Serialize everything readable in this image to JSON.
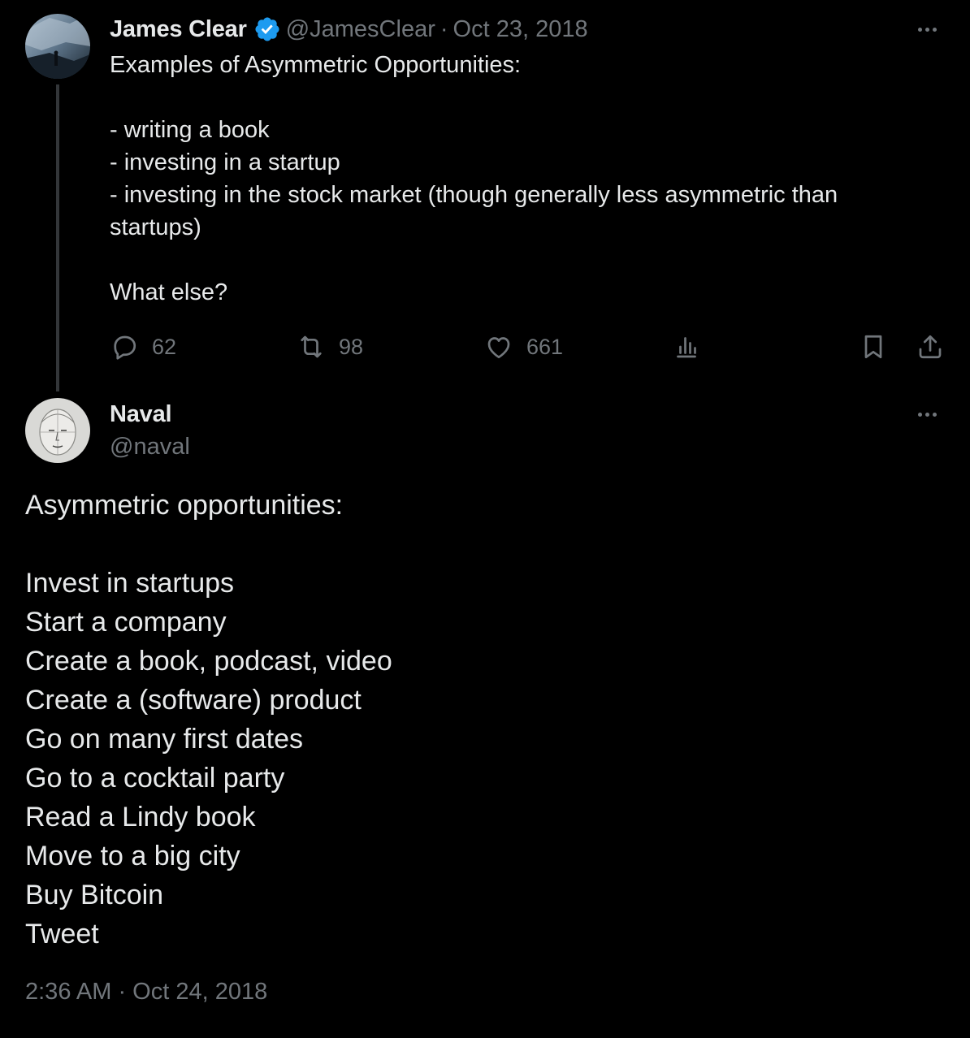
{
  "parent_tweet": {
    "author_name": "James Clear",
    "verified_icon": "verified-badge-icon",
    "handle": "@JamesClear",
    "separator": "·",
    "date": "Oct 23, 2018",
    "more_icon": "more-icon",
    "body_lines": [
      "Examples of Asymmetric Opportunities:",
      "",
      "- writing a book",
      "- investing in a startup",
      "- investing in the stock market (though generally less asymmetric than",
      "startups)",
      "",
      "What else?"
    ],
    "actions": {
      "reply": {
        "icon": "reply-icon",
        "count": "62"
      },
      "retweet": {
        "icon": "retweet-icon",
        "count": "98"
      },
      "like": {
        "icon": "heart-icon",
        "count": "661"
      },
      "views": {
        "icon": "views-icon"
      },
      "bookmark": {
        "icon": "bookmark-icon"
      },
      "share": {
        "icon": "share-icon"
      }
    }
  },
  "main_tweet": {
    "author_name": "Naval",
    "handle": "@naval",
    "more_icon": "more-icon",
    "body_lines": [
      "Asymmetric opportunities:",
      "",
      "Invest in startups",
      "Start a company",
      "Create a book, podcast, video",
      "Create a (software) product",
      "Go on many first dates",
      "Go to a cocktail party",
      "Read a Lindy book",
      "Move to a big city",
      "Buy Bitcoin",
      "Tweet"
    ],
    "timestamp": "2:36 AM · Oct 24, 2018"
  },
  "colors": {
    "background": "#000000",
    "primary_text": "#e7e9ea",
    "secondary_text": "#71767b",
    "verified_blue": "#1d9bf0",
    "thread_line": "#333639"
  }
}
